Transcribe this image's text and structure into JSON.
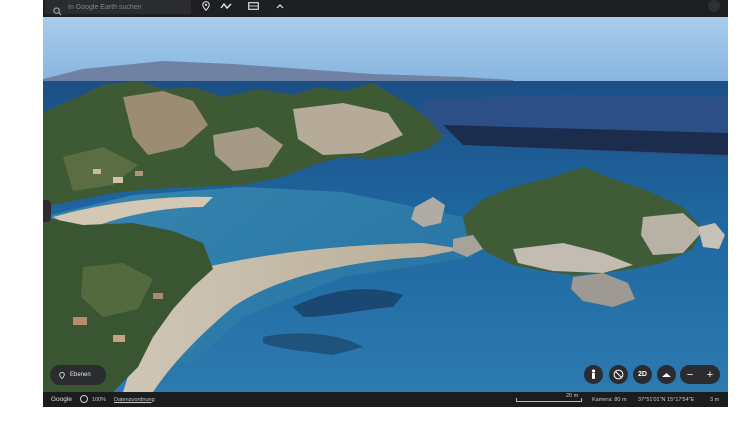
{
  "toolbar": {
    "search_placeholder": "In Google Earth suchen",
    "icons": [
      "search-icon",
      "placemark-icon",
      "path-icon",
      "overlay-icon",
      "chevron-up-icon",
      "more-icon"
    ]
  },
  "map": {
    "layers_label": "Ebenen",
    "mode_2d_label": "2D",
    "zoom_out_label": "−",
    "zoom_in_label": "+"
  },
  "status": {
    "brand": "Google",
    "percent": "100%",
    "data_attribution": "Datenzuordnung",
    "scale_label": "20 m",
    "camera": "Kamera: 80 m",
    "coordinates": "37°51'01\"N 15°17'54\"E",
    "elevation": "3 m"
  },
  "colors": {
    "toolbar_bg": "#1e1f21",
    "control_bg": "#2a2c30",
    "sea": "#1d5f93",
    "sky": "#9cc3e6"
  }
}
